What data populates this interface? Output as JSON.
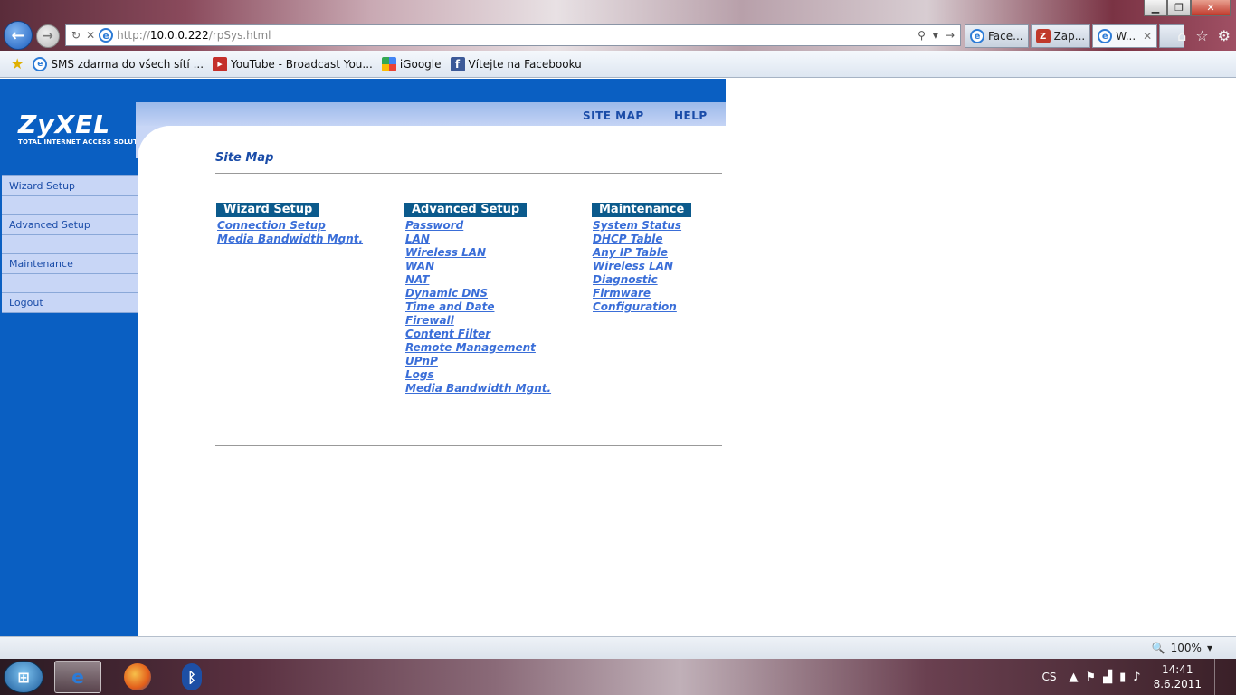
{
  "browser": {
    "window_controls": [
      "▁",
      "❐",
      "✕"
    ],
    "address": {
      "scheme": "http://",
      "host": "10.0.0.222",
      "path": "/rpSys.html"
    },
    "tabs": [
      {
        "label": "Face...",
        "icon": "ie-icon"
      },
      {
        "label": "Zap...",
        "icon": "zap-icon"
      },
      {
        "label": "W...",
        "icon": "ie-icon",
        "close": "✕"
      }
    ],
    "favorites": [
      {
        "label": "SMS zdarma do všech sítí ...",
        "icon": "ie-icon"
      },
      {
        "label": "YouTube - Broadcast You...",
        "icon": "youtube-icon"
      },
      {
        "label": "iGoogle",
        "icon": "google-icon"
      },
      {
        "label": "Vítejte na Facebooku",
        "icon": "facebook-icon"
      }
    ]
  },
  "router": {
    "logo": "ZyXEL",
    "logo_sub": "TOTAL INTERNET ACCESS SOLUTION",
    "header_links": {
      "site_map": "SITE MAP",
      "help": "HELP"
    },
    "sidebar": [
      "Wizard Setup",
      "Advanced Setup",
      "Maintenance",
      "Logout"
    ],
    "page_title": "Site Map",
    "columns": [
      {
        "heading": "Wizard Setup",
        "links": [
          "Connection Setup",
          "Media Bandwidth Mgnt."
        ]
      },
      {
        "heading": "Advanced Setup",
        "links": [
          "Password",
          "LAN",
          "Wireless LAN",
          "WAN",
          "NAT",
          "Dynamic DNS",
          "Time and Date",
          "Firewall",
          "Content Filter",
          "Remote Management",
          "UPnP",
          "Logs",
          "Media Bandwidth Mgnt."
        ]
      },
      {
        "heading": "Maintenance",
        "links": [
          "System Status",
          "DHCP Table",
          "Any IP Table",
          "Wireless LAN",
          "Diagnostic",
          "Firmware",
          "Configuration"
        ]
      }
    ]
  },
  "statusbar": {
    "zoom": "100%"
  },
  "taskbar": {
    "language": "CS",
    "time": "14:41",
    "date": "8.6.2011"
  },
  "colors": {
    "zyxel_blue": "#0a5fc2",
    "link_blue": "#3a6ed8",
    "heading_bg": "#0b5a8c"
  }
}
